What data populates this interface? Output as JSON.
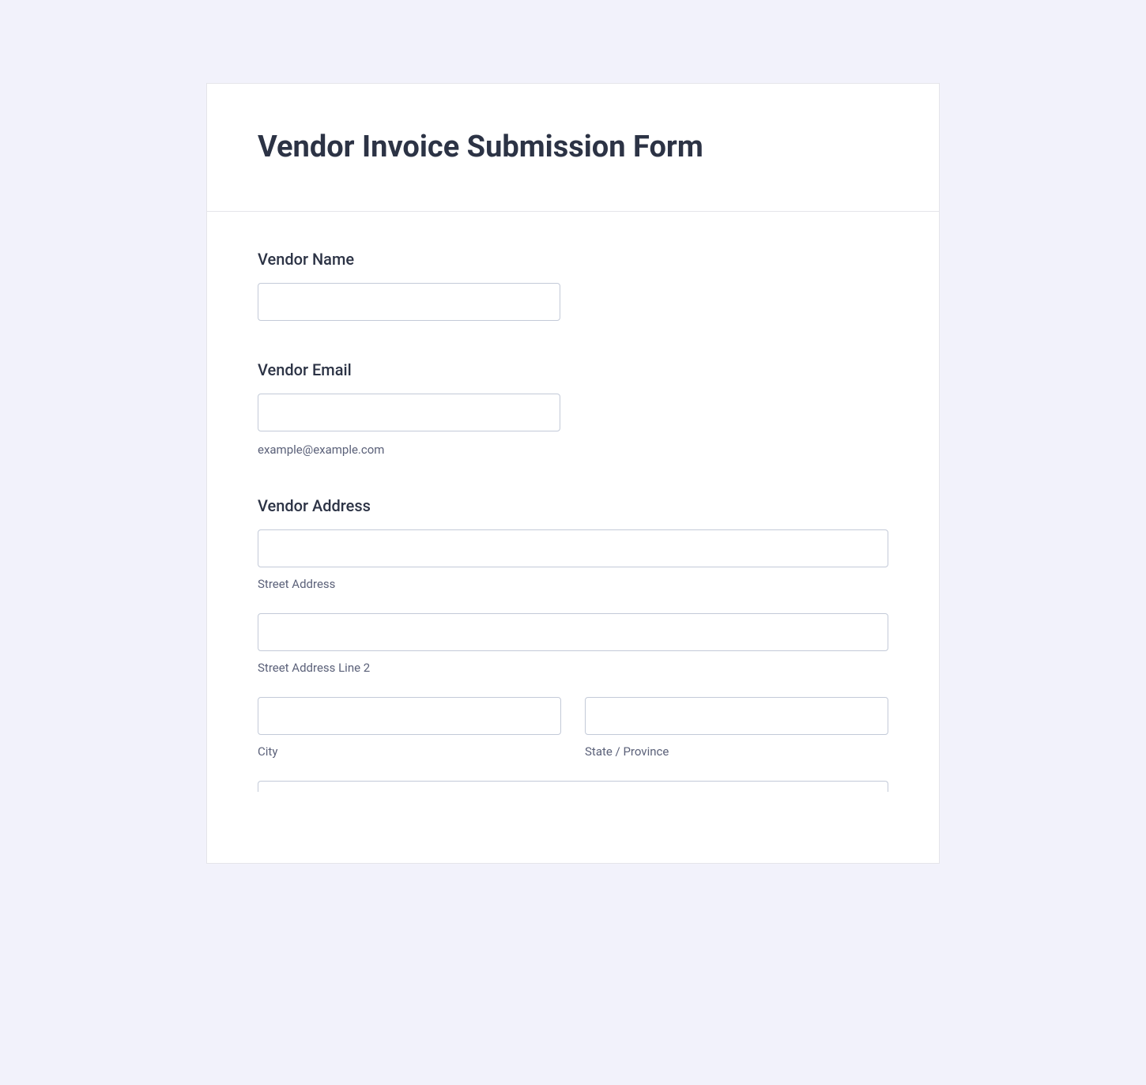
{
  "form": {
    "title": "Vendor Invoice Submission Form",
    "fields": {
      "vendor_name": {
        "label": "Vendor Name",
        "value": ""
      },
      "vendor_email": {
        "label": "Vendor Email",
        "value": "",
        "helper": "example@example.com"
      },
      "vendor_address": {
        "label": "Vendor Address",
        "street": {
          "value": "",
          "sublabel": "Street Address"
        },
        "street2": {
          "value": "",
          "sublabel": "Street Address Line 2"
        },
        "city": {
          "value": "",
          "sublabel": "City"
        },
        "state": {
          "value": "",
          "sublabel": "State / Province"
        }
      }
    }
  }
}
